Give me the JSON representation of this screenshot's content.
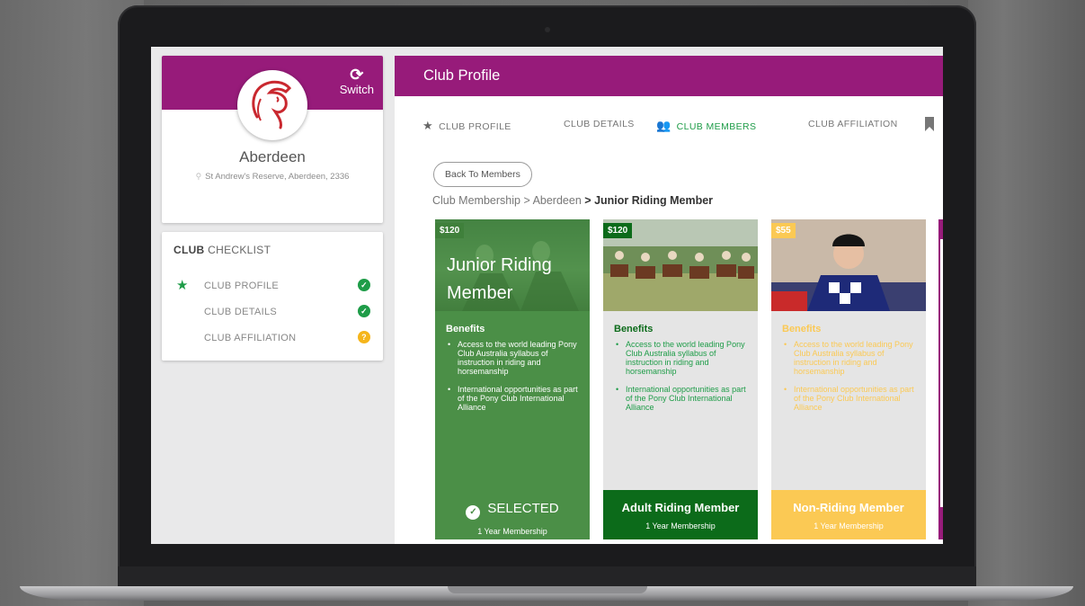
{
  "sidebar": {
    "switch_label": "Switch",
    "club_name": "Aberdeen",
    "club_address": "St Andrew's Reserve, Aberdeen, 2336",
    "checklist_title_bold": "CLUB",
    "checklist_title_rest": " CHECKLIST",
    "checklist": [
      {
        "label": "CLUB PROFILE",
        "status": "complete"
      },
      {
        "label": "CLUB DETAILS",
        "status": "complete"
      },
      {
        "label": "CLUB AFFILIATION",
        "status": "pending"
      }
    ]
  },
  "main": {
    "title": "Club Profile",
    "tabs": [
      {
        "label": "CLUB PROFILE",
        "icon": "star-icon",
        "active": false
      },
      {
        "label": "CLUB DETAILS",
        "active": false
      },
      {
        "label": "CLUB MEMBERS",
        "icon": "members-icon",
        "active": true
      },
      {
        "label": "CLUB AFFILIATION",
        "active": false
      }
    ],
    "back_button": "Back To Members",
    "breadcrumb": {
      "parts": [
        "Club Membership",
        "Aberdeen"
      ],
      "separator": ">",
      "current": "Junior Riding Member"
    },
    "cards": [
      {
        "price": "$120",
        "title": "Junior Riding Member",
        "benefits_title": "Benefits",
        "benefits": [
          "Access to the world leading Pony Club Australia syllabus of instruction in riding and horsemanship",
          "International opportunities as part of the Pony Club International Alliance"
        ],
        "footer_label": "SELECTED",
        "footer_sub": "1 Year Membership",
        "selected": true
      },
      {
        "price": "$120",
        "title": "Adult Riding Member",
        "benefits_title": "Benefits",
        "benefits": [
          "Access to the world leading Pony Club Australia syllabus of instruction in riding and horsemanship",
          "International opportunities as part of the Pony Club International Alliance"
        ],
        "footer_label": "Adult Riding Member",
        "footer_sub": "1 Year Membership",
        "selected": false
      },
      {
        "price": "$55",
        "title": "Non-Riding Member",
        "benefits_title": "Benefits",
        "benefits": [
          "Access to the world leading Pony Club Australia syllabus of instruction in riding and horsemanship",
          "International opportunities as part of the Pony Club International Alliance"
        ],
        "footer_label": "Non-Riding Member",
        "footer_sub": "1 Year Membership",
        "selected": false
      }
    ]
  },
  "colors": {
    "brand_purple": "#971b7a",
    "accent_green": "#1e9c48",
    "card_selected_green": "#4b8f47",
    "card_dark_green": "#0c6b1a",
    "card_yellow": "#fbc954",
    "status_warning": "#f5b51b"
  }
}
